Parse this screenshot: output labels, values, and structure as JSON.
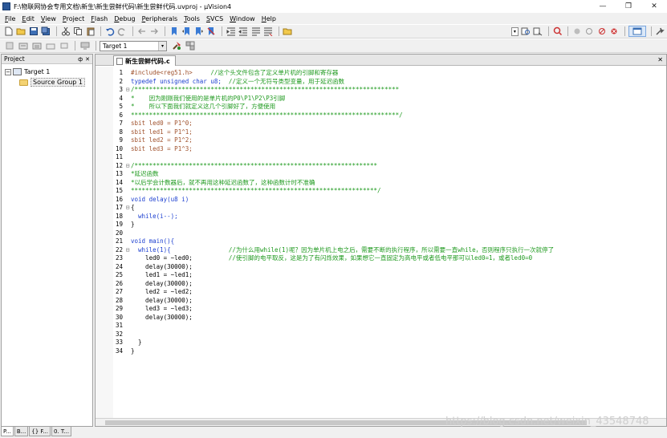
{
  "window": {
    "title": "F:\\物联网协会专用文档\\新生\\新生尝鲜代码\\新生尝鲜代码.uvproj - µVision4",
    "minimize": "—",
    "maximize": "❐",
    "close": "✕"
  },
  "menu": [
    {
      "label": "File",
      "ul": "F",
      "rest": "ile"
    },
    {
      "label": "Edit",
      "ul": "E",
      "rest": "dit"
    },
    {
      "label": "View",
      "ul": "V",
      "rest": "iew"
    },
    {
      "label": "Project",
      "ul": "P",
      "rest": "roject"
    },
    {
      "label": "Flash",
      "ul": "F",
      "rest": "lash"
    },
    {
      "label": "Debug",
      "ul": "D",
      "rest": "ebug"
    },
    {
      "label": "Peripherals",
      "ul": "P",
      "rest": "eripherals"
    },
    {
      "label": "Tools",
      "ul": "T",
      "rest": "ools"
    },
    {
      "label": "SVCS",
      "ul": "S",
      "rest": "VCS"
    },
    {
      "label": "Window",
      "ul": "W",
      "rest": "indow"
    },
    {
      "label": "Help",
      "ul": "H",
      "rest": "elp"
    }
  ],
  "toolbar2": {
    "target_select": "Target 1"
  },
  "project": {
    "header": "Project",
    "pin": "ф",
    "close": "✕",
    "expander": "−",
    "target": "Target 1",
    "group": "Source Group 1"
  },
  "editor": {
    "tab": "新生尝鲜代码.c",
    "tab_close": "✕"
  },
  "code_lines": [
    {
      "n": "1",
      "f": "",
      "segs": [
        {
          "t": "#include<reg51.h>",
          "c": "c-pp"
        },
        {
          "t": "     //这个头文件包含了定义单片机的引脚和寄存器",
          "c": "c-green"
        }
      ]
    },
    {
      "n": "2",
      "f": "",
      "segs": [
        {
          "t": "typedef unsigned char u8;",
          "c": "c-blue"
        },
        {
          "t": "  //定义一个无符号类型变量，用于延迟函数",
          "c": "c-green"
        }
      ]
    },
    {
      "n": "3",
      "f": "⊟",
      "segs": [
        {
          "t": "/*************************************************************************",
          "c": "c-green"
        }
      ]
    },
    {
      "n": "4",
      "f": "",
      "segs": [
        {
          "t": "*    因为刚刚我们使用的是单片机的P0\\P1\\P2\\P3引脚",
          "c": "c-green"
        }
      ]
    },
    {
      "n": "5",
      "f": "",
      "segs": [
        {
          "t": "*    所以下面我们就定义这几个引脚好了，方便使用",
          "c": "c-green"
        }
      ]
    },
    {
      "n": "6",
      "f": "",
      "segs": [
        {
          "t": "**************************************************************************/",
          "c": "c-green"
        }
      ]
    },
    {
      "n": "7",
      "f": "",
      "segs": [
        {
          "t": "sbit led0 = P1^0;",
          "c": "c-pp"
        }
      ]
    },
    {
      "n": "8",
      "f": "",
      "segs": [
        {
          "t": "sbit led1 = P1^1;",
          "c": "c-pp"
        }
      ]
    },
    {
      "n": "9",
      "f": "",
      "segs": [
        {
          "t": "sbit led2 = P1^2;",
          "c": "c-pp"
        }
      ]
    },
    {
      "n": "10",
      "f": "",
      "segs": [
        {
          "t": "sbit led3 = P1^3;",
          "c": "c-pp"
        }
      ]
    },
    {
      "n": "11",
      "f": "",
      "segs": [
        {
          "t": "",
          "c": "code"
        }
      ]
    },
    {
      "n": "12",
      "f": "⊟",
      "segs": [
        {
          "t": "/*******************************************************************",
          "c": "c-green"
        }
      ]
    },
    {
      "n": "13",
      "f": "",
      "segs": [
        {
          "t": "*延迟函数",
          "c": "c-green"
        }
      ]
    },
    {
      "n": "14",
      "f": "",
      "segs": [
        {
          "t": "*以后学会计数器后，就不再用这种延迟函数了，这种函数计时不准确",
          "c": "c-green"
        }
      ]
    },
    {
      "n": "15",
      "f": "",
      "segs": [
        {
          "t": "********************************************************************/",
          "c": "c-green"
        }
      ]
    },
    {
      "n": "16",
      "f": "",
      "segs": [
        {
          "t": "void delay(u8 i)",
          "c": "c-blue"
        }
      ]
    },
    {
      "n": "17",
      "f": "⊟",
      "segs": [
        {
          "t": "{",
          "c": "code"
        }
      ]
    },
    {
      "n": "18",
      "f": "",
      "segs": [
        {
          "t": "  while(i--);",
          "c": "c-blue"
        }
      ]
    },
    {
      "n": "19",
      "f": "",
      "segs": [
        {
          "t": "}",
          "c": "code"
        }
      ]
    },
    {
      "n": "20",
      "f": "",
      "segs": [
        {
          "t": "",
          "c": "code"
        }
      ]
    },
    {
      "n": "21",
      "f": "",
      "segs": [
        {
          "t": "void main(){",
          "c": "c-blue"
        }
      ]
    },
    {
      "n": "22",
      "f": "⊟",
      "segs": [
        {
          "t": "  while(1){",
          "c": "c-blue"
        },
        {
          "t": "                //为什么用while(1)呢？因为单片机上电之后，需要不断的执行程序，所以需要一直while，否则程序只执行一次就停了",
          "c": "c-green"
        }
      ]
    },
    {
      "n": "23",
      "f": "",
      "segs": [
        {
          "t": "    led0 = ~led0;",
          "c": "code"
        },
        {
          "t": "          //使引脚的电平取反，这是为了有闪烁效果，如果想它一直固定为高电平或者低电平那可以led0=1，或者led0=0",
          "c": "c-green"
        }
      ]
    },
    {
      "n": "24",
      "f": "",
      "segs": [
        {
          "t": "    delay(30000);",
          "c": "code"
        }
      ]
    },
    {
      "n": "25",
      "f": "",
      "segs": [
        {
          "t": "    led1 = ~led1;",
          "c": "code"
        }
      ]
    },
    {
      "n": "26",
      "f": "",
      "segs": [
        {
          "t": "    delay(30000);",
          "c": "code"
        }
      ]
    },
    {
      "n": "27",
      "f": "",
      "segs": [
        {
          "t": "    led2 = ~led2;",
          "c": "code"
        }
      ]
    },
    {
      "n": "28",
      "f": "",
      "segs": [
        {
          "t": "    delay(30000);",
          "c": "code"
        }
      ]
    },
    {
      "n": "29",
      "f": "",
      "segs": [
        {
          "t": "    led3 = ~led3;",
          "c": "code"
        }
      ]
    },
    {
      "n": "30",
      "f": "",
      "segs": [
        {
          "t": "    delay(30000);",
          "c": "code"
        }
      ]
    },
    {
      "n": "31",
      "f": "",
      "segs": [
        {
          "t": "",
          "c": "code"
        }
      ]
    },
    {
      "n": "32",
      "f": "",
      "segs": [
        {
          "t": "",
          "c": "code"
        }
      ]
    },
    {
      "n": "33",
      "f": "",
      "segs": [
        {
          "t": "  }",
          "c": "code"
        }
      ]
    },
    {
      "n": "34",
      "f": "",
      "segs": [
        {
          "t": "}",
          "c": "code"
        }
      ]
    }
  ],
  "bottom_tabs": [
    {
      "label": "P...",
      "active": true
    },
    {
      "label": "B...",
      "active": false
    },
    {
      "label": "{} F...",
      "active": false
    },
    {
      "label": "0. T...",
      "active": false
    }
  ],
  "watermark": "https://blog.csdn.net/weixin_43548748",
  "colors": {
    "comment": "#1f9a1f",
    "keyword": "#1c3fd0",
    "preprocessor": "#a0522d"
  }
}
